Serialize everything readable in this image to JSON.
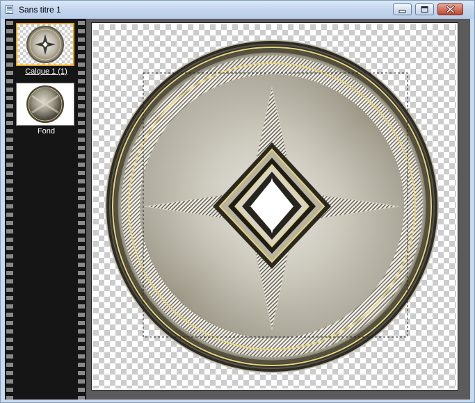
{
  "window": {
    "title": "Sans titre 1"
  },
  "layers": [
    {
      "name": "Calque 1 (1)",
      "selected": true
    },
    {
      "name": "Fond",
      "selected": false
    }
  ],
  "icons": {
    "app": "document-icon",
    "minimize": "minimize-icon",
    "maximize": "maximize-icon",
    "close": "close-icon"
  },
  "colors": {
    "selection_border": "#f0a000",
    "close_button": "#c1472f",
    "medallion_base": "#b5b1a3",
    "medallion_gold": "#e7d37c"
  }
}
